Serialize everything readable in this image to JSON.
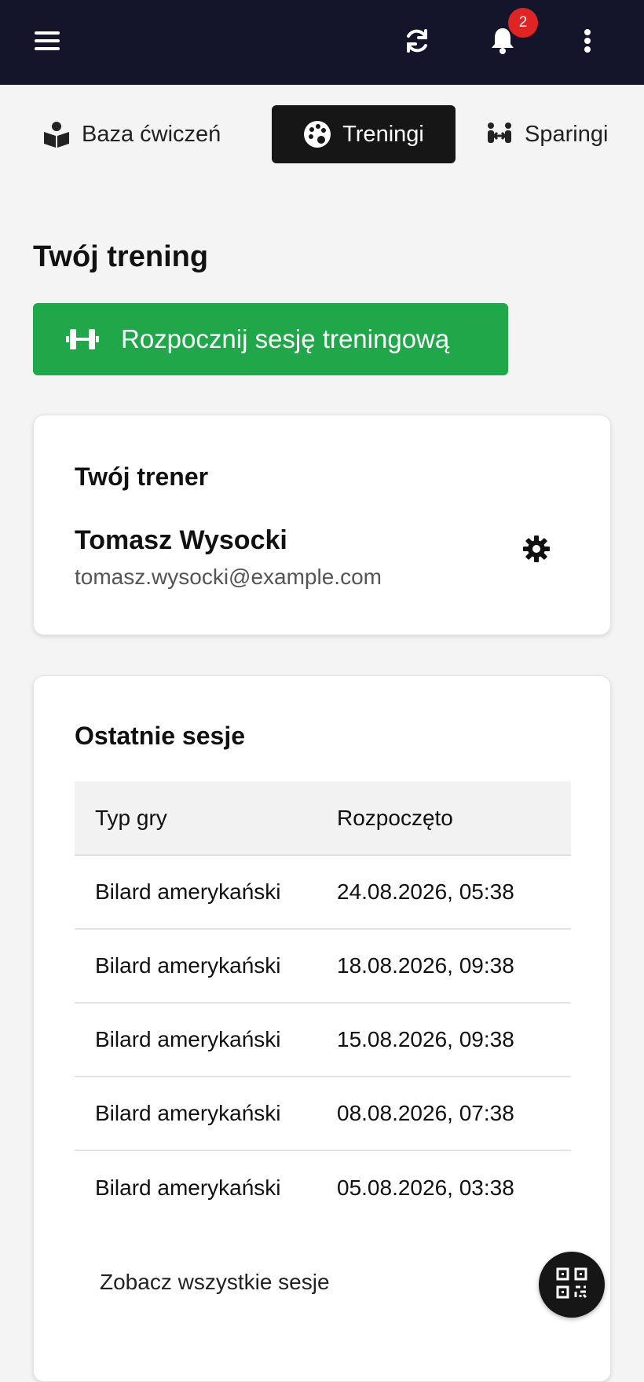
{
  "header": {
    "notification_count": "2",
    "icons": [
      "menu-icon",
      "sync-icon",
      "bell-icon",
      "more-vertical-icon"
    ]
  },
  "tabs": [
    {
      "label": "Baza ćwiczeń",
      "icon": "book-user-icon",
      "active": false
    },
    {
      "label": "Treningi",
      "icon": "palette-icon",
      "active": true
    },
    {
      "label": "Sparingi",
      "icon": "people-arrows-icon",
      "active": false
    }
  ],
  "page": {
    "title": "Twój trening",
    "start_button_label": "Rozpocznij sesję treningową",
    "start_button_icon": "dumbbell-icon"
  },
  "trainer_card": {
    "title": "Twój trener",
    "name": "Tomasz Wysocki",
    "email": "tomasz.wysocki@example.com"
  },
  "sessions_card": {
    "title": "Ostatnie sesje",
    "columns": [
      "Typ gry",
      "Rozpoczęto"
    ],
    "rows": [
      {
        "game_type": "Bilard amerykański",
        "started": "24.08.2026, 05:38"
      },
      {
        "game_type": "Bilard amerykański",
        "started": "18.08.2026, 09:38"
      },
      {
        "game_type": "Bilard amerykański",
        "started": "15.08.2026, 09:38"
      },
      {
        "game_type": "Bilard amerykański",
        "started": "08.08.2026, 07:38"
      },
      {
        "game_type": "Bilard amerykański",
        "started": "05.08.2026, 03:38"
      }
    ],
    "see_all_label": "Zobacz wszystkie sesje"
  },
  "colors": {
    "topbar": "#14142b",
    "accent_green": "#20a74a",
    "badge_red": "#e02424",
    "active_tab": "#161616"
  }
}
